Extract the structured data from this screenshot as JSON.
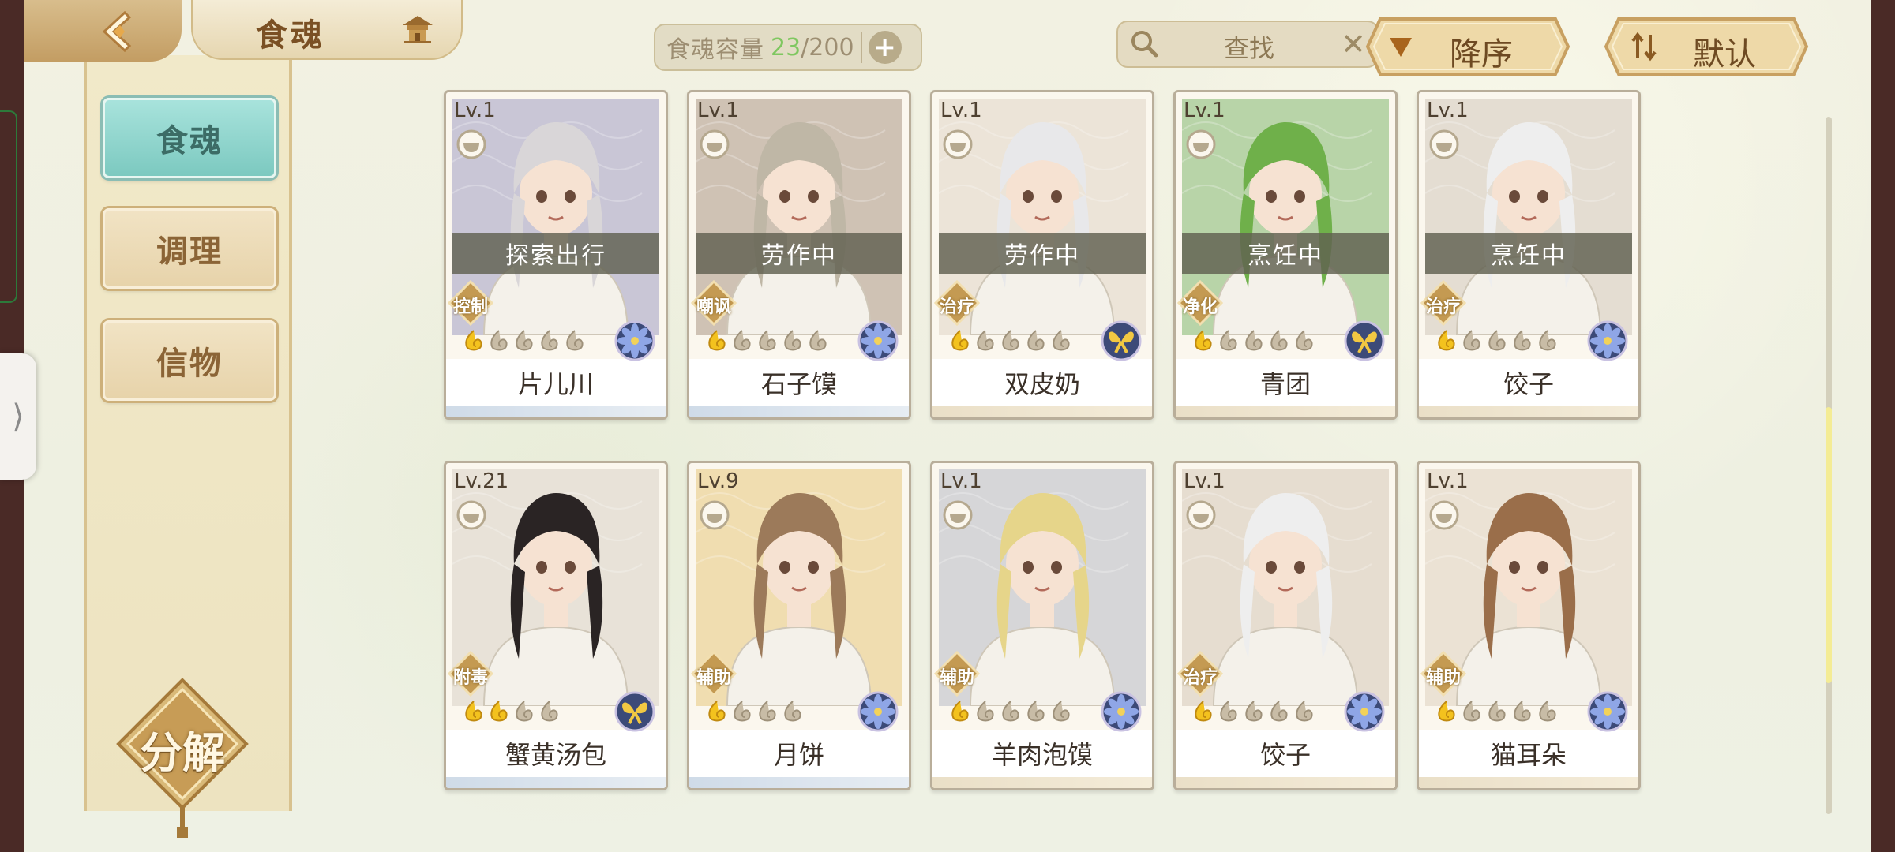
{
  "header": {
    "title": "食魂",
    "capacity_label": "食魂容量",
    "capacity_current": "23",
    "capacity_max": "/200",
    "search_text": "查找",
    "sort_label": "降序",
    "filter_label": "默认"
  },
  "sidebar": {
    "items": [
      {
        "label": "食魂",
        "active": true
      },
      {
        "label": "调理",
        "active": false
      },
      {
        "label": "信物",
        "active": false
      }
    ],
    "decompose_label": "分解"
  },
  "colors": {
    "accent_active": "#7cc9c0",
    "capacity_highlight": "#7fc760",
    "scroll_thumb": "#f4ec95"
  },
  "cards": [
    {
      "level": "Lv.1",
      "name": "片儿川",
      "status": "探索出行",
      "role": "控制",
      "stars_filled": 1,
      "stars_total": 5,
      "element": "flower-blue",
      "art_hue": "#c9c6d6",
      "hair": "#d9d6d8"
    },
    {
      "level": "Lv.1",
      "name": "石子馍",
      "status": "劳作中",
      "role": "嘲讽",
      "stars_filled": 1,
      "stars_total": 5,
      "element": "flower-blue",
      "art_hue": "#cfc2b4",
      "hair": "#bfb7a6"
    },
    {
      "level": "Lv.1",
      "name": "双皮奶",
      "status": "劳作中",
      "role": "治疗",
      "stars_filled": 1,
      "stars_total": 5,
      "element": "butterfly-gold",
      "art_hue": "#ece4d8",
      "hair": "#e8e8ea"
    },
    {
      "level": "Lv.1",
      "name": "青团",
      "status": "烹饪中",
      "role": "净化",
      "stars_filled": 1,
      "stars_total": 5,
      "element": "butterfly-gold",
      "art_hue": "#b8d4a8",
      "hair": "#6fb04a"
    },
    {
      "level": "Lv.1",
      "name": "饺子",
      "status": "烹饪中",
      "role": "治疗",
      "stars_filled": 1,
      "stars_total": 5,
      "element": "flower-blue",
      "art_hue": "#e4ddd2",
      "hair": "#eeeeee"
    },
    {
      "level": "Lv.21",
      "name": "蟹黄汤包",
      "status": "",
      "role": "附毒",
      "stars_filled": 2,
      "stars_total": 4,
      "element": "butterfly-gold",
      "art_hue": "#e8e2d8",
      "hair": "#2a2424"
    },
    {
      "level": "Lv.9",
      "name": "月饼",
      "status": "",
      "role": "辅助",
      "stars_filled": 1,
      "stars_total": 4,
      "element": "flower-blue",
      "art_hue": "#f0ddb0",
      "hair": "#9c7a5a"
    },
    {
      "level": "Lv.1",
      "name": "羊肉泡馍",
      "status": "",
      "role": "辅助",
      "stars_filled": 1,
      "stars_total": 5,
      "element": "flower-blue",
      "art_hue": "#d6d6d8",
      "hair": "#e6d58a"
    },
    {
      "level": "Lv.1",
      "name": "饺子",
      "status": "",
      "role": "治疗",
      "stars_filled": 1,
      "stars_total": 5,
      "element": "flower-blue",
      "art_hue": "#e6ddd0",
      "hair": "#eeeeee"
    },
    {
      "level": "Lv.1",
      "name": "猫耳朵",
      "status": "",
      "role": "辅助",
      "stars_filled": 1,
      "stars_total": 5,
      "element": "flower-blue",
      "art_hue": "#ebe2d4",
      "hair": "#9a6e4a"
    }
  ]
}
